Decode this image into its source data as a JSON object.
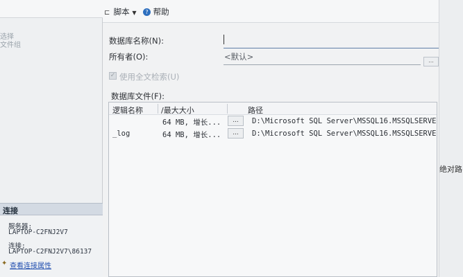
{
  "left_pane": {
    "items": [
      "选择",
      "文件组"
    ],
    "connection": {
      "header": "连接",
      "server_label": "服务器:",
      "server_value": "LAPTOP-C2FNJ2V7",
      "conn_label": "连接:",
      "conn_value": "LAPTOP-C2FNJ2V7\\86137",
      "view_props_link": "查看连接属性"
    }
  },
  "toolbar": {
    "script_label": "脚本",
    "help_label": "帮助"
  },
  "form": {
    "db_name_label": "数据库名称(N):",
    "db_name_value": "",
    "owner_label": "所有者(O):",
    "owner_value": "<默认>",
    "owner_browse": "...",
    "fulltext_label": "使用全文检索(U)",
    "files_label": "数据库文件(F):"
  },
  "grid": {
    "columns": [
      "逻辑名称",
      "/最大大小",
      "路径"
    ],
    "rows": [
      {
        "logical_name": "",
        "size": "64 MB, 增长...",
        "browse": "...",
        "path": "D:\\Microsoft SQL Server\\MSSQL16.MSSQLSERVER\\MSSQL"
      },
      {
        "logical_name": "_log",
        "size": "64 MB, 增长...",
        "browse": "...",
        "path": "D:\\Microsoft SQL Server\\MSSQL16.MSSQLSERVER\\MSSQL"
      }
    ]
  },
  "right_edge_label": "绝对路"
}
